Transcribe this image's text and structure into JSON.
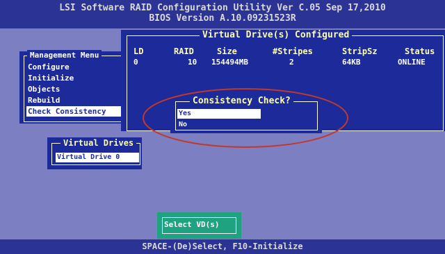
{
  "header": {
    "line1": "LSI Software RAID Configuration Utility Ver C.05 Sep 17,2010",
    "line2": "BIOS Version   A.10.09231523R"
  },
  "management_menu": {
    "title": "Management Menu",
    "items": [
      {
        "label": "Configure"
      },
      {
        "label": "Initialize"
      },
      {
        "label": "Objects"
      },
      {
        "label": "Rebuild"
      },
      {
        "label": "Check Consistency"
      }
    ],
    "selected_index": 4
  },
  "virtual_drives_configured": {
    "title": "Virtual Drive(s) Configured",
    "columns": [
      "LD",
      "RAID",
      "Size",
      "#Stripes",
      "StripSz",
      "Status"
    ],
    "rows": [
      {
        "LD": "0",
        "RAID": "10",
        "Size": "154494MB",
        "Stripes": "2",
        "StripSz": "64KB",
        "Status": "ONLINE"
      }
    ]
  },
  "consistency_check": {
    "title": "Consistency Check?",
    "options": [
      {
        "label": "Yes"
      },
      {
        "label": "No"
      }
    ],
    "selected_index": 0
  },
  "virtual_drives": {
    "title": "Virtual Drives",
    "items": [
      {
        "label": "Virtual Drive 0"
      }
    ]
  },
  "select_button": {
    "label": "Select VD(s)"
  },
  "footer": {
    "hint": "SPACE-(De)Select,    F10-Initialize"
  },
  "colors": {
    "background": "#7c7fc2",
    "panel": "#1c2a9a",
    "title_bar": "#2b3394",
    "highlight_text": "#ffffaa",
    "button": "#1fa27f",
    "annotation_ellipse": "#c0392b"
  }
}
